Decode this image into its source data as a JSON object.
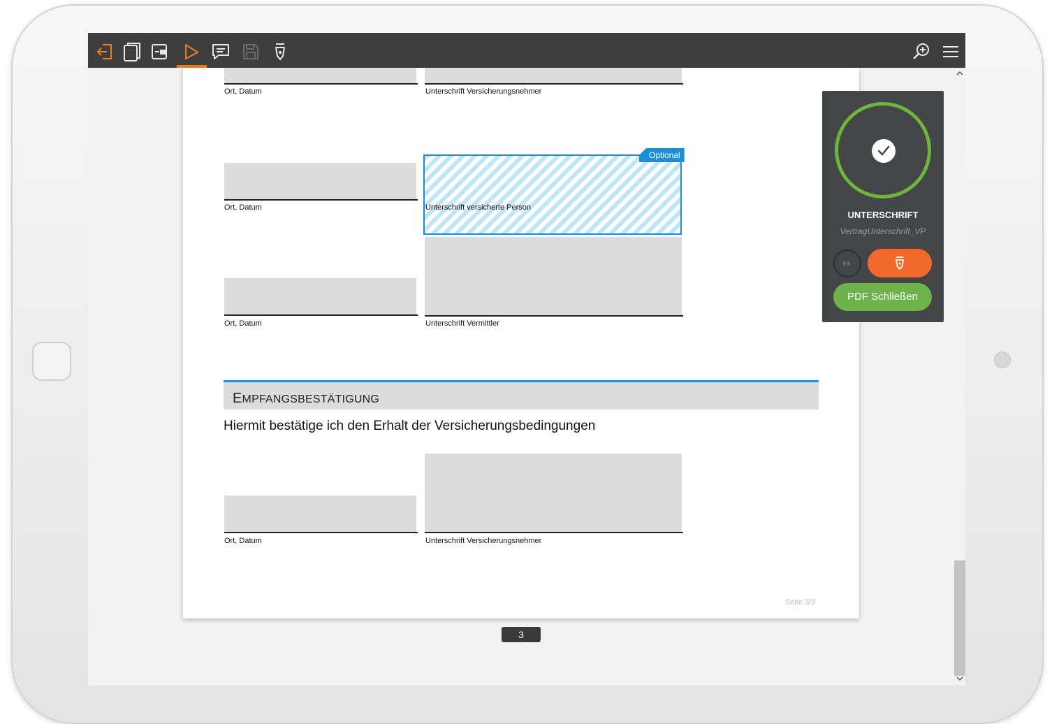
{
  "toolbar": {
    "icons": [
      "exit-icon",
      "pages-icon",
      "move-icon",
      "select-pointer-icon",
      "comment-icon",
      "save-icon",
      "pen-nib-icon",
      "zoom-in-icon",
      "menu-icon"
    ],
    "accent": "#f07d1b"
  },
  "document": {
    "top_fields": {
      "left_label": "Ort, Datum",
      "right_label": "Unterschrift Versicherungsnehmer"
    },
    "row2": {
      "left_label": "Ort, Datum",
      "right_label": "Unterschrift versicherte Person",
      "badge": "Optional"
    },
    "row3": {
      "left_label": "Ort, Datum",
      "right_label": "Unterschrift Vermittler"
    },
    "section": {
      "title_first": "E",
      "title_rest": "MPFANGSBESTÄTIGUNG",
      "text": "Hiermit bestätige ich den Erhalt der Versicherungsbedingungen"
    },
    "row4": {
      "left_label": "Ort, Datum",
      "right_label": "Unterschrift Versicherungsnehmer"
    },
    "page_footer": "Seite 3/3"
  },
  "page_indicator": "3",
  "panel": {
    "title": "UNTERSCHRIFT",
    "subtitle": "VertragUnterschrift_VP",
    "close_label": "PDF Schließen",
    "ring_color": "#6fb43c",
    "sign_color": "#f26a2b",
    "close_color": "#6db24a"
  }
}
